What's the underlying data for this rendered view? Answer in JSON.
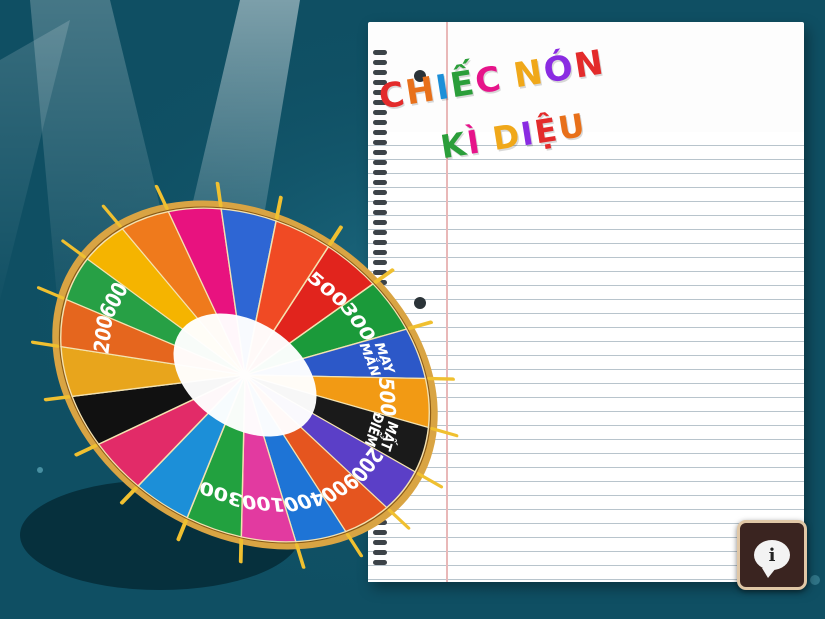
{
  "title": {
    "line1": "CHIẾC NÓN",
    "line2": "KÌ DIỆU"
  },
  "title_colors": [
    "#e32b2b",
    "#e8701a",
    "#1c8fd8",
    "#2b9e3a",
    "#e6148a",
    "#f0a81a",
    "#8a2be2"
  ],
  "wheel": {
    "segments": [
      {
        "label": "500",
        "color": "#e1241d"
      },
      {
        "label": "300",
        "color": "#1b9a3a"
      },
      {
        "label": "MAY MẮN",
        "color": "#2c58c8"
      },
      {
        "label": "500",
        "color": "#f29a14"
      },
      {
        "label": "MẤT ĐIỂM",
        "color": "#1a1a1a"
      },
      {
        "label": "200",
        "color": "#5b3fc7"
      },
      {
        "label": "900",
        "color": "#e5551f"
      },
      {
        "label": "400",
        "color": "#1e74d6"
      },
      {
        "label": "100",
        "color": "#e23aa0"
      },
      {
        "label": "300",
        "color": "#22a13f"
      },
      {
        "label": "",
        "color": "#1c8fd8"
      },
      {
        "label": "",
        "color": "#e22b68"
      },
      {
        "label": "",
        "color": "#111111"
      },
      {
        "label": "",
        "color": "#e8a51c"
      },
      {
        "label": "200",
        "color": "#e5661e"
      },
      {
        "label": "600",
        "color": "#27a045"
      },
      {
        "label": "",
        "color": "#f5b400"
      },
      {
        "label": "",
        "color": "#ef7a1c"
      },
      {
        "label": "",
        "color": "#e8127f"
      },
      {
        "label": "",
        "color": "#2e66d4"
      },
      {
        "label": "",
        "color": "#f04a24"
      }
    ]
  },
  "info_button": {
    "glyph": "i"
  },
  "colors": {
    "background": "#0f4f63",
    "rim": "#d9a443",
    "pin": "#f0c030"
  }
}
